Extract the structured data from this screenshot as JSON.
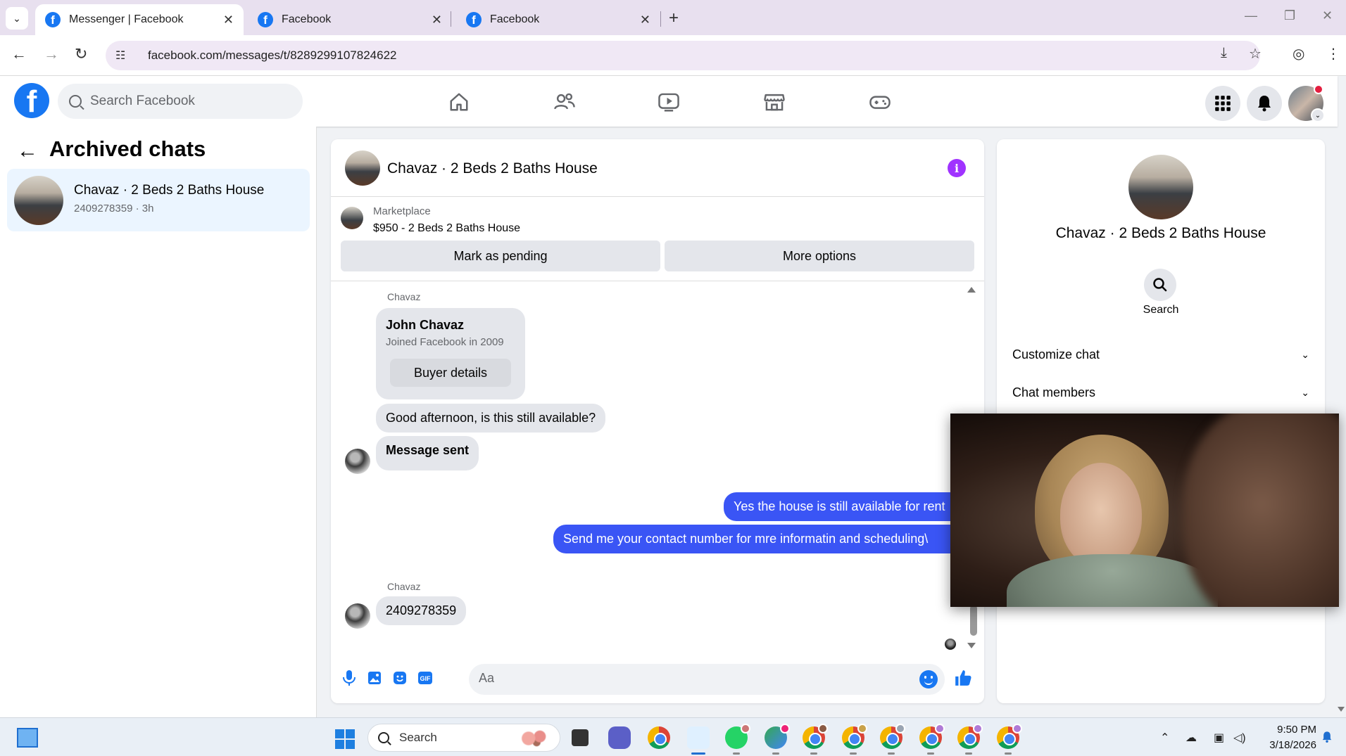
{
  "browser": {
    "tabs": [
      {
        "title": "Messenger | Facebook",
        "active": true
      },
      {
        "title": "Facebook",
        "active": false
      },
      {
        "title": "Facebook",
        "active": false
      }
    ],
    "url": "facebook.com/messages/t/8289299107824622"
  },
  "fb_nav": {
    "search_placeholder": "Search Facebook",
    "brand_color": "#1877f2"
  },
  "left_panel": {
    "title": "Archived chats",
    "chats": [
      {
        "name": "Chavaz · 2 Beds 2 Baths House",
        "subtitle": "2409278359 · 3h"
      }
    ]
  },
  "chat": {
    "title": "Chavaz · 2 Beds 2 Baths House",
    "marketplace": {
      "label": "Marketplace",
      "item": "$950 - 2 Beds 2 Baths House",
      "mark_pending_label": "Mark as pending",
      "more_options_label": "More options"
    },
    "messages": {
      "sender_1": "Chavaz",
      "buyer_name": "John Chavaz",
      "buyer_joined": "Joined Facebook in 2009",
      "buyer_details_label": "Buyer details",
      "incoming_1": "Good afternoon, is this still available?",
      "incoming_2": "Message sent",
      "outgoing_1": "Yes the house is still available for rent",
      "outgoing_2": "Send me your contact number for mre informatin and  scheduling\\",
      "sender_2": "Chavaz",
      "incoming_3": "2409278359"
    },
    "composer_placeholder": "Aa",
    "outgoing_bubble_color": "#3a55f5"
  },
  "right_panel": {
    "title": "Chavaz · 2 Beds 2 Baths House",
    "search_label": "Search",
    "sections": [
      {
        "label": "Customize chat"
      },
      {
        "label": "Chat members"
      }
    ]
  },
  "taskbar": {
    "search_label": "Search",
    "time": "9:50 PM",
    "date": "3/18/2026"
  }
}
